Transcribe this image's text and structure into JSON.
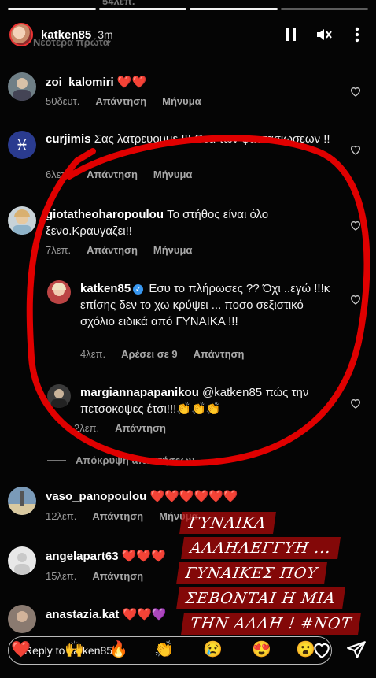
{
  "ghost_top": "54λεπ.",
  "header": {
    "username": "katken85",
    "time": "3m",
    "sort_label": "Νεότερα πρώτα"
  },
  "comments": [
    {
      "user": "zoi_kalomiri",
      "text": "❤️❤️",
      "time": "50δευτ.",
      "reply": "Απάντηση",
      "message": "Μήνυμα",
      "avatar_color": "#6f7f86"
    },
    {
      "user": "curjimis",
      "text": "Σας λατρευουμε !!! Θεα των φαντασιωσεων !!",
      "time": "6λεπ.",
      "reply": "Απάντηση",
      "message": "Μήνυμα",
      "avatar_color": "#2a3b8f"
    },
    {
      "user": "giotatheoharopoulou",
      "text": "Το στήθος είναι όλο ξενο.Κραυγαζει!!",
      "time": "7λεπ.",
      "reply": "Απάντηση",
      "message": "Μήνυμα",
      "avatar_color": "#c9d3d8"
    },
    {
      "user": "katken85",
      "text": "Εσυ το πλήρωσες ?? Όχι ..εγώ !!!κ επίσης δεν το χω κρύψει ... ποσο σεξιστικό σχόλιο ειδικά από ΓΥΝΑΙΚΑ !!!",
      "time": "4λεπ.",
      "likes": "Αρέσει σε 9",
      "reply": "Απάντηση",
      "avatar_color": "#b44"
    },
    {
      "user": "margiannapapanikou",
      "text": "@katken85 πώς την πετσοκοψες έτσι!!!👏👏👏",
      "time": "2λεπ.",
      "reply": "Απάντηση",
      "avatar_color": "#3a3a3a"
    },
    {
      "user": "vaso_panopoulou",
      "text": "❤️❤️❤️❤️❤️❤️",
      "time": "12λεπ.",
      "reply": "Απάντηση",
      "message": "Μήνυμα",
      "avatar_color": "#7a9ab8"
    },
    {
      "user": "angelapart63",
      "text": "❤️❤️❤️",
      "time": "15λεπ.",
      "reply": "Απάντηση",
      "avatar_color": "#e8e8e8"
    },
    {
      "user": "anastazia.kat",
      "text": "❤️❤️💜",
      "avatar_color": "#8a7a70"
    }
  ],
  "hide_replies": "Απόκρυψη απαντήσεων",
  "overlay_lines": [
    "ΓΥΝΑΙΚΑ",
    "ΑΛΛΗΛΕΓΓΥΗ ...",
    "ΓΥΝΑΙΚΕΣ ΠΟΥ",
    "ΣΕΒΟΝΤΑΙ Η ΜΙΑ",
    "ΤΗΝ ΑΛΛΗ ! #NOT"
  ],
  "reply_bar": {
    "placeholder": "Reply to katken85..."
  },
  "emoji_strip": [
    "❤️",
    "🙌",
    "🔥",
    "👏",
    "😢",
    "😍",
    "😮",
    "😂"
  ],
  "colors": {
    "background": "#050505",
    "annotation_red": "#e00000",
    "overlay_bg": "#b40a0a",
    "verified_blue": "#3897f0"
  }
}
